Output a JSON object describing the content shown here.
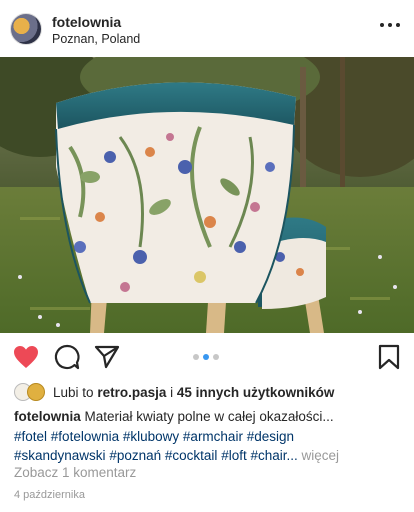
{
  "post": {
    "username": "fotelownia",
    "location": "Poznan, Poland"
  },
  "carousel": {
    "count": 3,
    "active_index": 1,
    "accent": "#3897f0"
  },
  "likes": {
    "prefix": "Lubi to",
    "liker": "retro.pasja",
    "middle": "i",
    "others": "45 innych użytkowników"
  },
  "caption": {
    "author": "fotelownia",
    "text": "Materiał kwiaty polne w całej okazałości...",
    "hashtags_line1": [
      "#fotel",
      "#fotelownia",
      "#klubowy",
      "#armchair",
      "#design"
    ],
    "hashtags_line2": [
      "#skandynawski",
      "#poznań",
      "#cocktail",
      "#loft",
      "#chair..."
    ],
    "more_label": "więcej"
  },
  "comments_label": "Zobacz 1 komentarz",
  "date": "4 października",
  "colors": {
    "heart": "#ed4956",
    "hashtag": "#003569",
    "muted": "#999999"
  },
  "icons": [
    "more-options-icon",
    "heart-icon",
    "comment-icon",
    "share-icon",
    "bookmark-icon"
  ]
}
